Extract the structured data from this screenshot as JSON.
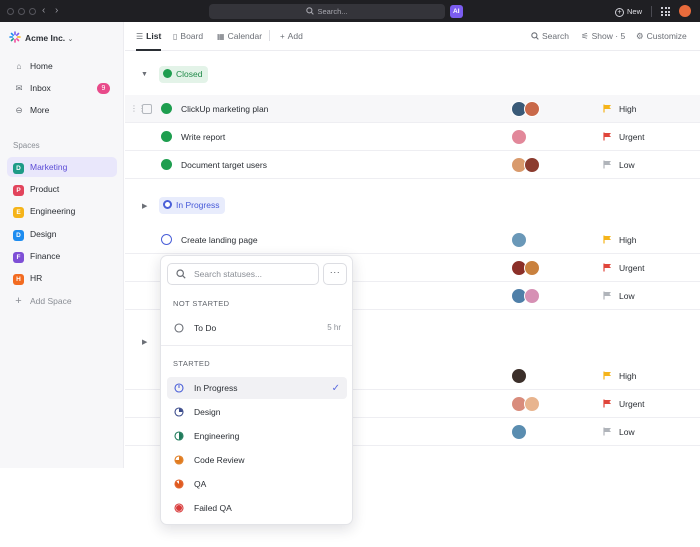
{
  "titlebar": {
    "search_placeholder": "Search...",
    "ai_label": "AI",
    "new_label": "New",
    "icons": [
      "back-arrow-icon",
      "forward-arrow-icon",
      "search-icon",
      "apps-grid-icon",
      "user-avatar"
    ]
  },
  "sidebar": {
    "workspace": "Acme Inc.",
    "nav": [
      {
        "label": "Home",
        "icon": "home-icon"
      },
      {
        "label": "Inbox",
        "icon": "inbox-icon",
        "badge": "9"
      },
      {
        "label": "More",
        "icon": "more-icon"
      }
    ],
    "spaces_heading": "Spaces",
    "spaces": [
      {
        "letter": "D",
        "label": "Marketing",
        "color": "#1e9b86",
        "active": true
      },
      {
        "letter": "P",
        "label": "Product",
        "color": "#e2445c"
      },
      {
        "letter": "E",
        "label": "Engineering",
        "color": "#f5b41a"
      },
      {
        "letter": "D",
        "label": "Design",
        "color": "#1d8cf0"
      },
      {
        "letter": "F",
        "label": "Finance",
        "color": "#7e4fd6"
      },
      {
        "letter": "H",
        "label": "HR",
        "color": "#f26b21"
      }
    ],
    "add_space": "Add Space"
  },
  "views": {
    "tabs": [
      "List",
      "Board",
      "Calendar"
    ],
    "add": "Add",
    "search": "Search",
    "show": "Show · 5",
    "customize": "Customize"
  },
  "groups": [
    {
      "status": "Closed",
      "color": "#1e9e4f",
      "tasks": [
        {
          "name": "ClickUp marketing plan",
          "priority": "High",
          "priority_color": "#f5b41a",
          "avatars": [
            "#3a5a78",
            "#c9694a"
          ]
        },
        {
          "name": "Write report",
          "priority": "Urgent",
          "priority_color": "#e0453a",
          "avatars": [
            "#e2889a"
          ]
        },
        {
          "name": "Document target users",
          "priority": "Low",
          "priority_color": "#b0b4ba",
          "avatars": [
            "#d99a6c",
            "#8b3b2e"
          ]
        }
      ]
    },
    {
      "status": "In Progress",
      "color": "#4a5fd8",
      "tasks": [
        {
          "name": "Create landing page",
          "priority": "High",
          "priority_color": "#f5b41a",
          "avatars": [
            "#6a98b8"
          ]
        },
        {
          "priority": "Urgent",
          "priority_color": "#e0453a",
          "avatars": [
            "#8b2f28",
            "#c9813e"
          ]
        },
        {
          "priority": "Low",
          "priority_color": "#b0b4ba",
          "avatars": [
            "#4f7fa8",
            "#d690b4"
          ]
        }
      ]
    },
    {
      "tasks": [
        {
          "priority": "High",
          "priority_color": "#f5b41a",
          "avatars": [
            "#3b2f2a"
          ]
        },
        {
          "priority": "Urgent",
          "priority_color": "#e0453a",
          "avatars": [
            "#d98c7c",
            "#e8b48e"
          ]
        },
        {
          "priority": "Low",
          "priority_color": "#b0b4ba",
          "avatars": [
            "#5a8db0"
          ]
        }
      ]
    }
  ],
  "status_menu": {
    "search_placeholder": "Search statuses...",
    "more": "···",
    "not_started_heading": "NOT STARTED",
    "not_started": [
      {
        "label": "To Do",
        "meta": "5 hr"
      }
    ],
    "started_heading": "STARTED",
    "started": [
      {
        "label": "In Progress",
        "color": "#4a5fd8",
        "selected": true
      },
      {
        "label": "Design",
        "color": "#3a4a8a"
      },
      {
        "label": "Engineering",
        "color": "#1e7a5a"
      },
      {
        "label": "Code Review",
        "color": "#e07b1f"
      },
      {
        "label": "QA",
        "color": "#e05a1f"
      },
      {
        "label": "Failed QA",
        "color": "#d83a3a"
      }
    ]
  }
}
